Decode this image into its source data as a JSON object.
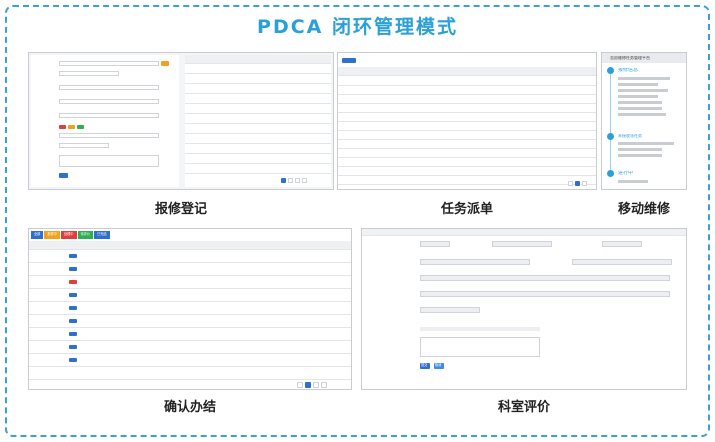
{
  "title": "PDCA 闭环管理模式",
  "panels": {
    "repair_register": {
      "caption": "报修登记"
    },
    "task_dispatch": {
      "caption": "任务派单"
    },
    "mobile_repair": {
      "caption": "移动维修",
      "app_title": "志愿维修任务管理平台",
      "step1_label": "报修信息",
      "step2_label": "未接收派任务",
      "step3_label": "进行中"
    },
    "confirm_close": {
      "caption": "确认办结",
      "tabs": [
        "全部",
        "报修中",
        "处理中",
        "待评价",
        "已完结"
      ]
    },
    "dept_eval": {
      "caption": "科室评价",
      "submit_label": "提交",
      "cancel_label": "取消"
    }
  },
  "colors": {
    "accent": "#2aa0d8",
    "frame": "#3aa0d6",
    "primary_button": "#2f6fcf",
    "warning": "#f0a21c",
    "danger": "#e23d3d",
    "success": "#2fae52"
  }
}
